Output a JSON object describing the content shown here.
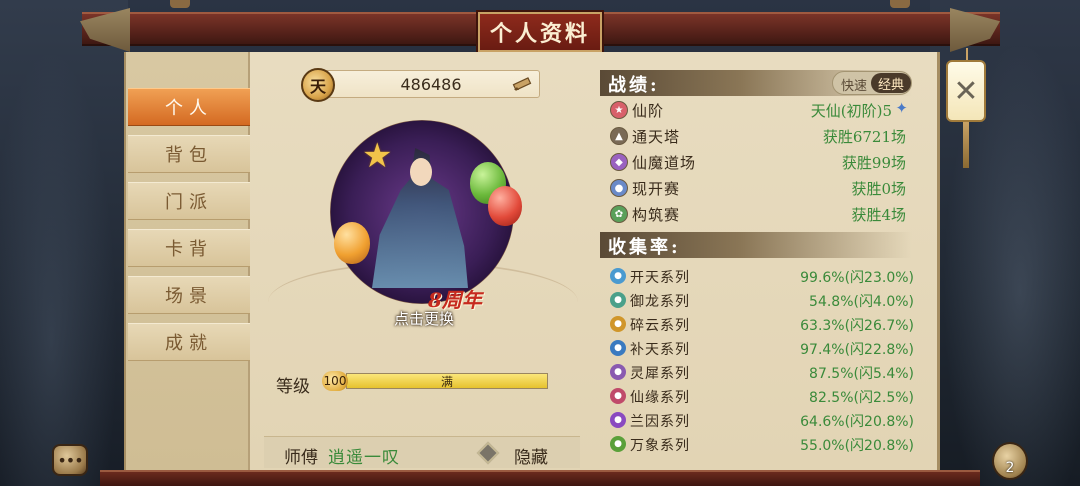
{
  "window": {
    "title": "个人资料"
  },
  "nav": {
    "items": [
      {
        "label": "个人",
        "active": true
      },
      {
        "label": "背包",
        "active": false
      },
      {
        "label": "门派",
        "active": false
      },
      {
        "label": "卡背",
        "active": false
      },
      {
        "label": "场景",
        "active": false
      },
      {
        "label": "成就",
        "active": false
      }
    ]
  },
  "profile": {
    "currency_icon_text": "天",
    "currency_value": "486486",
    "portrait_badge": "8周年",
    "portrait_hint": "点击更换",
    "level_label": "等级",
    "level_value": "100",
    "level_bar_text": "满",
    "level_progress": 1.0,
    "master_label": "师傅",
    "master_name": "逍遥一叹",
    "hide_label": "隐藏"
  },
  "record": {
    "title": "战绩:",
    "toggle_fast": "快速",
    "toggle_classic": "经典",
    "rows": [
      {
        "label": "仙阶",
        "value": "天仙(初阶)5",
        "icon_color": "#d8606a"
      },
      {
        "label": "通天塔",
        "value": "获胜6721场",
        "icon_color": "#7a6a56"
      },
      {
        "label": "仙魔道场",
        "value": "获胜99场",
        "icon_color": "#9a62c0"
      },
      {
        "label": "现开赛",
        "value": "获胜0场",
        "icon_color": "#6a8ac8"
      },
      {
        "label": "构筑赛",
        "value": "获胜4场",
        "icon_color": "#5aa05a"
      }
    ]
  },
  "collection": {
    "title": "收集率:",
    "rows": [
      {
        "label": "开天系列",
        "value": "99.6%(闪23.0%)",
        "icon_color": "#4a9ad0"
      },
      {
        "label": "御龙系列",
        "value": "54.8%(闪4.0%)",
        "icon_color": "#4aa08a"
      },
      {
        "label": "碎云系列",
        "value": "63.3%(闪26.7%)",
        "icon_color": "#d0962a"
      },
      {
        "label": "补天系列",
        "value": "97.4%(闪22.8%)",
        "icon_color": "#3a7ac0"
      },
      {
        "label": "灵犀系列",
        "value": "87.5%(闪5.4%)",
        "icon_color": "#8a5ab0"
      },
      {
        "label": "仙缘系列",
        "value": "82.5%(闪2.5%)",
        "icon_color": "#c04a6a"
      },
      {
        "label": "兰因系列",
        "value": "64.6%(闪20.8%)",
        "icon_color": "#8a4ac0"
      },
      {
        "label": "万象系列",
        "value": "55.0%(闪20.8%)",
        "icon_color": "#5aa03a"
      }
    ]
  },
  "corner": {
    "chat_icon_text": "•••",
    "gift_badge": "2"
  },
  "colors": {
    "accent_active": "#d46a22",
    "value_green": "#3a8a3a",
    "header_red": "#6a1c12"
  }
}
